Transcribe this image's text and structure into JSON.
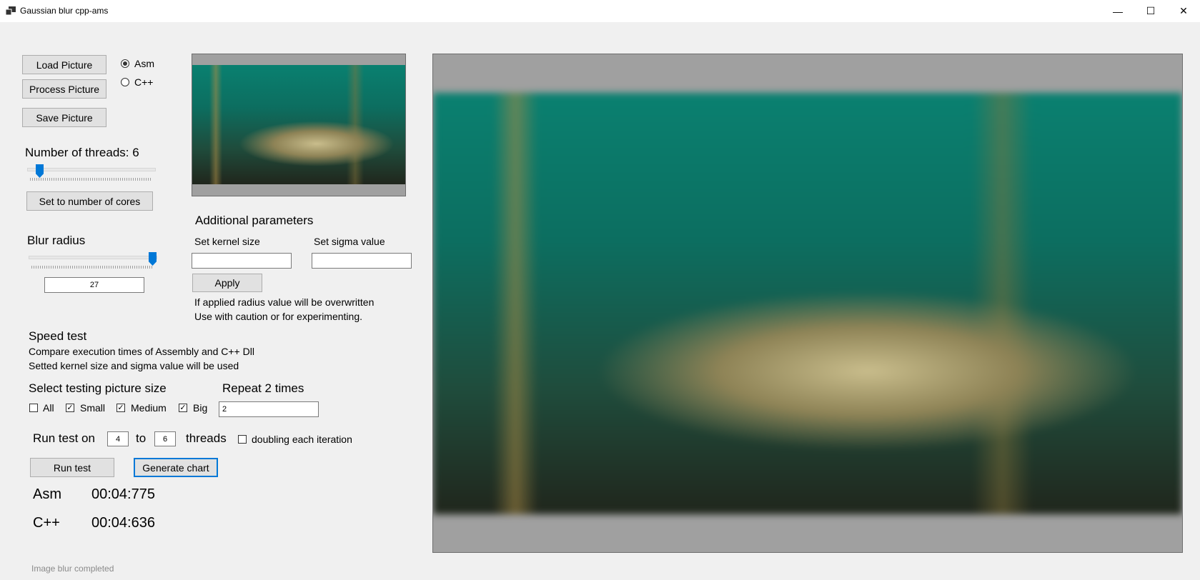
{
  "window": {
    "title": "Gaussian blur cpp-ams",
    "minimize_glyph": "—",
    "maximize_glyph": "☐",
    "close_glyph": "✕"
  },
  "buttons": {
    "load": "Load Picture",
    "process": "Process Picture",
    "save": "Save Picture",
    "set_cores": "Set to number of cores",
    "apply": "Apply",
    "run_test": "Run test",
    "generate_chart": "Generate chart"
  },
  "mode": {
    "asm_label": "Asm",
    "cpp_label": "C++",
    "selected": "Asm"
  },
  "threads": {
    "label": "Number of threads: 6",
    "value": 6,
    "min": 1,
    "max": 64
  },
  "blur": {
    "label": "Blur radius",
    "slider_fraction": 0.97,
    "value": "27"
  },
  "additional": {
    "title": "Additional parameters",
    "kernel_label": "Set kernel size",
    "kernel_value": "",
    "sigma_label": "Set sigma value",
    "sigma_value": "",
    "note_line1": "If applied radius value will be overwritten",
    "note_line2": "Use with caution or for experimenting."
  },
  "speed": {
    "title": "Speed test",
    "desc_line1": "Compare execution times of Assembly and C++ Dll",
    "desc_line2": "Setted kernel size and sigma value will be used",
    "size_label": "Select testing picture size",
    "repeat_label": "Repeat 2 times",
    "repeat_value": "2",
    "sizes": [
      {
        "label": "All",
        "checked": false
      },
      {
        "label": "Small",
        "checked": true
      },
      {
        "label": "Medium",
        "checked": true
      },
      {
        "label": "Big",
        "checked": true
      }
    ],
    "run_on_label": "Run test on",
    "from_value": "4",
    "to_label": "to",
    "to_value": "6",
    "threads_label": "threads",
    "doubling_label": "doubling each iteration",
    "doubling_checked": false
  },
  "results": {
    "asm_label": "Asm",
    "asm_time": "00:04:775",
    "cpp_label": "C++",
    "cpp_time": "00:04:636"
  },
  "status": "Image blur completed",
  "colors": {
    "accent": "#0078d7",
    "frame": "#a0a0a0",
    "status_text": "#8a8a8a"
  }
}
